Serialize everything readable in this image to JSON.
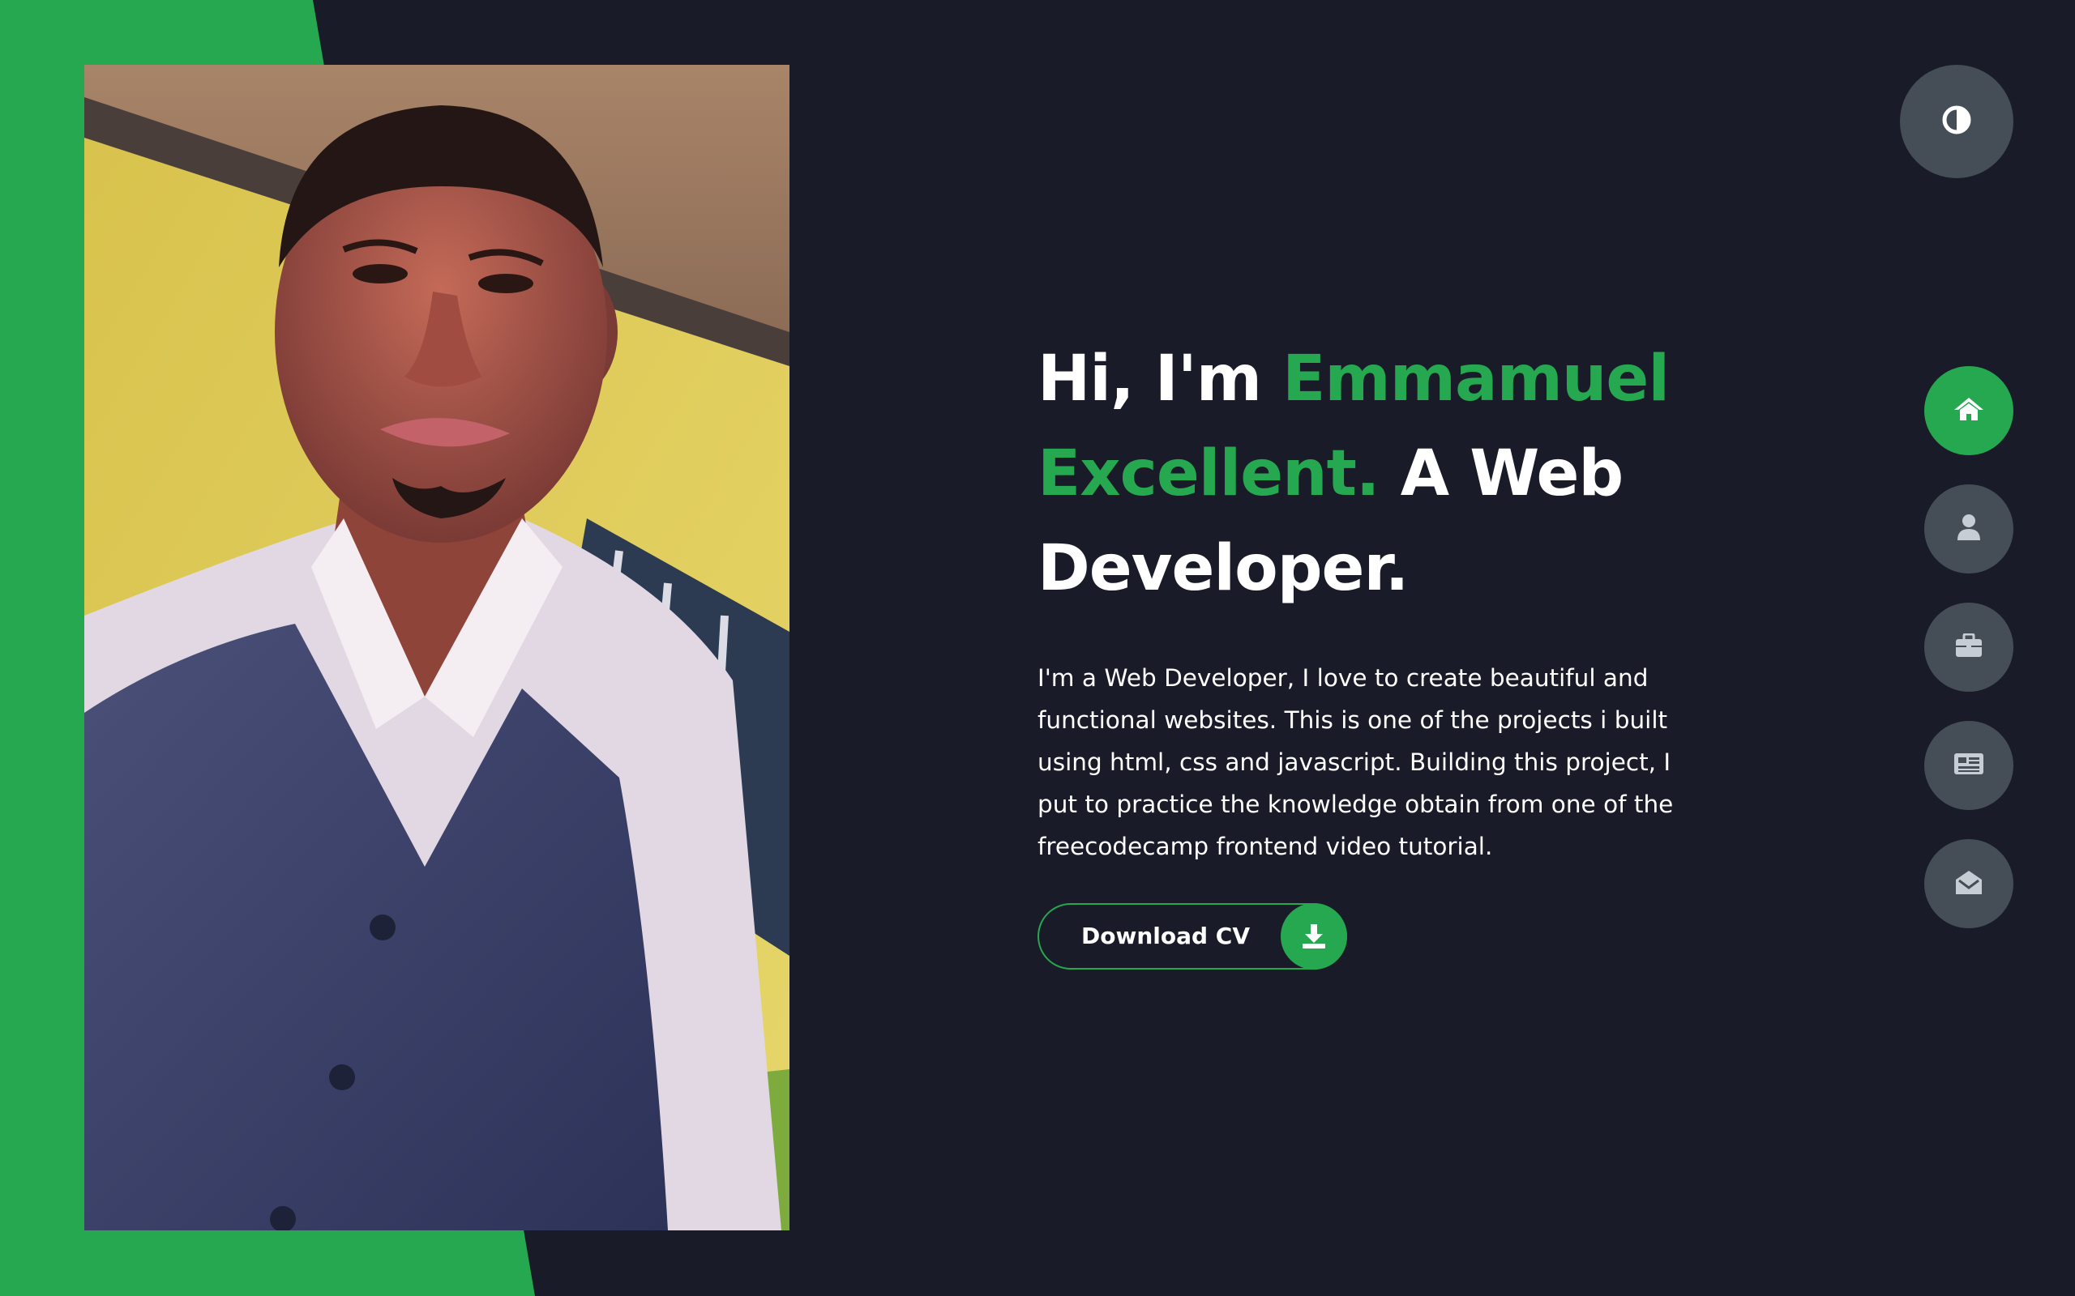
{
  "hero": {
    "greeting": "Hi, I'm",
    "name_line1": "Emmamuel",
    "name_line2": "Excellent.",
    "role_part1": "A Web",
    "role_part2": "Developer.",
    "description": "I'm a Web Developer, I love to create beautiful and functional websites. This is one of the projects i built using html, css and javascript. Building this project, I put to practice the knowledge obtain from one of the freecodecamp frontend video tutorial.",
    "button_label": "Download CV"
  },
  "icons": {
    "theme": "half-circle-icon",
    "download": "download-icon",
    "nav": [
      "home-icon",
      "user-icon",
      "briefcase-icon",
      "newspaper-icon",
      "envelope-open-icon"
    ]
  },
  "colors": {
    "background": "#191b28",
    "accent": "#25a84f",
    "control": "#454e56",
    "text": "#ffffff"
  }
}
